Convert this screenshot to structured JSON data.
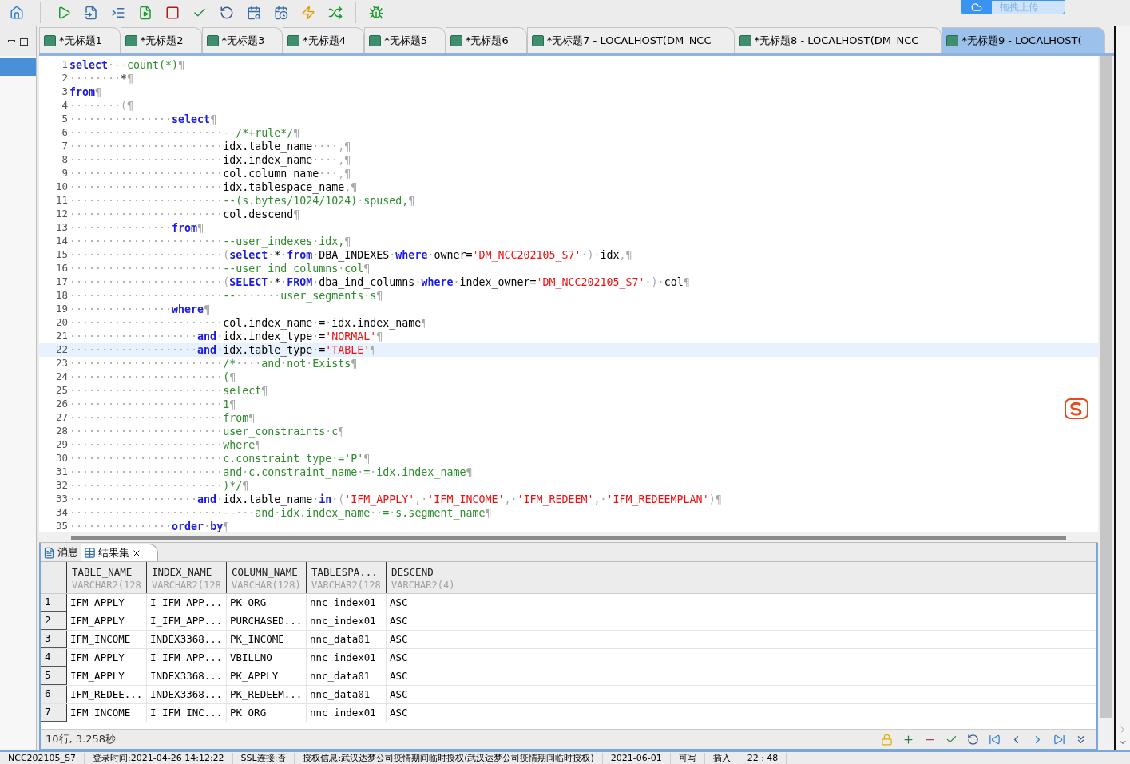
{
  "toolbar": {
    "upload_button": "拖拽上传"
  },
  "tabs": [
    {
      "label": "*无标题1",
      "selected": false
    },
    {
      "label": "*无标题2",
      "selected": false
    },
    {
      "label": "*无标题3",
      "selected": false
    },
    {
      "label": "*无标题4",
      "selected": false
    },
    {
      "label": "*无标题5",
      "selected": false
    },
    {
      "label": "*无标题6",
      "selected": false
    },
    {
      "label": "*无标题7 - LOCALHOST(DM_NCC",
      "selected": false
    },
    {
      "label": "*无标题8 - LOCALHOST(DM_NCC",
      "selected": false
    },
    {
      "label": "*无标题9 - LOCALHOST(",
      "selected": true
    }
  ],
  "editor": {
    "lines": [
      {
        "number": "1",
        "current": false,
        "segments": [
          {
            "kind": "kw",
            "text": "select"
          },
          {
            "kind": "ws",
            "text": "·"
          },
          {
            "kind": "cm",
            "text": "--count(*)"
          },
          {
            "kind": "ws",
            "text": "¶"
          }
        ]
      },
      {
        "number": "2",
        "current": false,
        "segments": [
          {
            "kind": "ws",
            "text": "········"
          },
          {
            "kind": "pl",
            "text": "*"
          },
          {
            "kind": "ws",
            "text": "¶"
          }
        ]
      },
      {
        "number": "3",
        "current": false,
        "segments": [
          {
            "kind": "kw",
            "text": "from"
          },
          {
            "kind": "ws",
            "text": "¶"
          }
        ]
      },
      {
        "number": "4",
        "current": false,
        "segments": [
          {
            "kind": "ws",
            "text": "········(¶"
          }
        ]
      },
      {
        "number": "5",
        "current": false,
        "segments": [
          {
            "kind": "ws",
            "text": "················"
          },
          {
            "kind": "kw",
            "text": "select"
          },
          {
            "kind": "ws",
            "text": "¶"
          }
        ]
      },
      {
        "number": "6",
        "current": false,
        "segments": [
          {
            "kind": "ws",
            "text": "························"
          },
          {
            "kind": "cm",
            "text": "--/*+rule*/"
          },
          {
            "kind": "ws",
            "text": "¶"
          }
        ]
      },
      {
        "number": "7",
        "current": false,
        "segments": [
          {
            "kind": "ws",
            "text": "························"
          },
          {
            "kind": "pl",
            "text": "idx.table_name"
          },
          {
            "kind": "ws",
            "text": "····,¶"
          }
        ]
      },
      {
        "number": "8",
        "current": false,
        "segments": [
          {
            "kind": "ws",
            "text": "························"
          },
          {
            "kind": "pl",
            "text": "idx.index_name"
          },
          {
            "kind": "ws",
            "text": "····,¶"
          }
        ]
      },
      {
        "number": "9",
        "current": false,
        "segments": [
          {
            "kind": "ws",
            "text": "························"
          },
          {
            "kind": "pl",
            "text": "col.column_name"
          },
          {
            "kind": "ws",
            "text": "···,¶"
          }
        ]
      },
      {
        "number": "10",
        "current": false,
        "segments": [
          {
            "kind": "ws",
            "text": "························"
          },
          {
            "kind": "pl",
            "text": "idx.tablespace_name"
          },
          {
            "kind": "ws",
            "text": ",¶"
          }
        ]
      },
      {
        "number": "11",
        "current": false,
        "segments": [
          {
            "kind": "ws",
            "text": "························"
          },
          {
            "kind": "cm",
            "text": "--(s.bytes/1024/1024)"
          },
          {
            "kind": "ws",
            "text": "·"
          },
          {
            "kind": "cm",
            "text": "spused,"
          },
          {
            "kind": "ws",
            "text": "¶"
          }
        ]
      },
      {
        "number": "12",
        "current": false,
        "segments": [
          {
            "kind": "ws",
            "text": "························"
          },
          {
            "kind": "pl",
            "text": "col.descend"
          },
          {
            "kind": "ws",
            "text": "¶"
          }
        ]
      },
      {
        "number": "13",
        "current": false,
        "segments": [
          {
            "kind": "ws",
            "text": "················"
          },
          {
            "kind": "kw",
            "text": "from"
          },
          {
            "kind": "ws",
            "text": "¶"
          }
        ]
      },
      {
        "number": "14",
        "current": false,
        "segments": [
          {
            "kind": "ws",
            "text": "························"
          },
          {
            "kind": "cm",
            "text": "--user_indexes"
          },
          {
            "kind": "ws",
            "text": "·"
          },
          {
            "kind": "cm",
            "text": "idx,"
          },
          {
            "kind": "ws",
            "text": "¶"
          }
        ]
      },
      {
        "number": "15",
        "current": false,
        "segments": [
          {
            "kind": "ws",
            "text": "························("
          },
          {
            "kind": "kw",
            "text": "select"
          },
          {
            "kind": "ws",
            "text": "·"
          },
          {
            "kind": "pl",
            "text": "*"
          },
          {
            "kind": "ws",
            "text": "·"
          },
          {
            "kind": "kw",
            "text": "from"
          },
          {
            "kind": "ws",
            "text": "·"
          },
          {
            "kind": "pl",
            "text": "DBA_INDEXES"
          },
          {
            "kind": "ws",
            "text": "·"
          },
          {
            "kind": "kw",
            "text": "where"
          },
          {
            "kind": "ws",
            "text": "·"
          },
          {
            "kind": "pl",
            "text": "owner="
          },
          {
            "kind": "st",
            "text": "'DM_NCC202105_S7'"
          },
          {
            "kind": "ws",
            "text": "·)·"
          },
          {
            "kind": "pl",
            "text": "idx"
          },
          {
            "kind": "ws",
            "text": ",¶"
          }
        ]
      },
      {
        "number": "16",
        "current": false,
        "segments": [
          {
            "kind": "ws",
            "text": "························"
          },
          {
            "kind": "cm",
            "text": "--user_ind_columns"
          },
          {
            "kind": "ws",
            "text": "·"
          },
          {
            "kind": "cm",
            "text": "col"
          },
          {
            "kind": "ws",
            "text": "¶"
          }
        ]
      },
      {
        "number": "17",
        "current": false,
        "segments": [
          {
            "kind": "ws",
            "text": "························("
          },
          {
            "kind": "kw",
            "text": "SELECT"
          },
          {
            "kind": "ws",
            "text": "·"
          },
          {
            "kind": "pl",
            "text": "*"
          },
          {
            "kind": "ws",
            "text": "·"
          },
          {
            "kind": "kw",
            "text": "FROM"
          },
          {
            "kind": "ws",
            "text": "·"
          },
          {
            "kind": "pl",
            "text": "dba_ind_columns"
          },
          {
            "kind": "ws",
            "text": "·"
          },
          {
            "kind": "kw",
            "text": "where"
          },
          {
            "kind": "ws",
            "text": "·"
          },
          {
            "kind": "pl",
            "text": "index_owner="
          },
          {
            "kind": "st",
            "text": "'DM_NCC202105_S7'"
          },
          {
            "kind": "ws",
            "text": "·)·"
          },
          {
            "kind": "pl",
            "text": "col"
          },
          {
            "kind": "ws",
            "text": "¶"
          }
        ]
      },
      {
        "number": "18",
        "current": false,
        "segments": [
          {
            "kind": "ws",
            "text": "························"
          },
          {
            "kind": "cm",
            "text": "--"
          },
          {
            "kind": "ws",
            "text": "·······"
          },
          {
            "kind": "cm",
            "text": "user_segments"
          },
          {
            "kind": "ws",
            "text": "·"
          },
          {
            "kind": "cm",
            "text": "s"
          },
          {
            "kind": "ws",
            "text": "¶"
          }
        ]
      },
      {
        "number": "19",
        "current": false,
        "segments": [
          {
            "kind": "ws",
            "text": "················"
          },
          {
            "kind": "kw",
            "text": "where"
          },
          {
            "kind": "ws",
            "text": "¶"
          }
        ]
      },
      {
        "number": "20",
        "current": false,
        "segments": [
          {
            "kind": "ws",
            "text": "························"
          },
          {
            "kind": "pl",
            "text": "col.index_name"
          },
          {
            "kind": "ws",
            "text": "·"
          },
          {
            "kind": "pl",
            "text": "="
          },
          {
            "kind": "ws",
            "text": "·"
          },
          {
            "kind": "pl",
            "text": "idx.index_name"
          },
          {
            "kind": "ws",
            "text": "¶"
          }
        ]
      },
      {
        "number": "21",
        "current": false,
        "segments": [
          {
            "kind": "ws",
            "text": "····················"
          },
          {
            "kind": "kw",
            "text": "and"
          },
          {
            "kind": "ws",
            "text": "·"
          },
          {
            "kind": "pl",
            "text": "idx.index_type"
          },
          {
            "kind": "ws",
            "text": "·"
          },
          {
            "kind": "pl",
            "text": "="
          },
          {
            "kind": "st",
            "text": "'NORMAL'"
          },
          {
            "kind": "ws",
            "text": "¶"
          }
        ]
      },
      {
        "number": "22",
        "current": true,
        "segments": [
          {
            "kind": "ws",
            "text": "····················"
          },
          {
            "kind": "kw",
            "text": "and"
          },
          {
            "kind": "ws",
            "text": "·"
          },
          {
            "kind": "pl",
            "text": "idx.table_type"
          },
          {
            "kind": "ws",
            "text": "·"
          },
          {
            "kind": "pl",
            "text": "="
          },
          {
            "kind": "st",
            "text": "'TABLE'"
          },
          {
            "kind": "ws",
            "text": "¶"
          }
        ]
      },
      {
        "number": "23",
        "current": false,
        "segments": [
          {
            "kind": "ws",
            "text": "························"
          },
          {
            "kind": "cm",
            "text": "/*"
          },
          {
            "kind": "ws",
            "text": "····"
          },
          {
            "kind": "cm",
            "text": "and"
          },
          {
            "kind": "ws",
            "text": "·"
          },
          {
            "kind": "cm",
            "text": "not"
          },
          {
            "kind": "ws",
            "text": "·"
          },
          {
            "kind": "cm",
            "text": "Exists"
          },
          {
            "kind": "ws",
            "text": "¶"
          }
        ]
      },
      {
        "number": "24",
        "current": false,
        "segments": [
          {
            "kind": "ws",
            "text": "························"
          },
          {
            "kind": "cm",
            "text": "("
          },
          {
            "kind": "ws",
            "text": "¶"
          }
        ]
      },
      {
        "number": "25",
        "current": false,
        "segments": [
          {
            "kind": "ws",
            "text": "························"
          },
          {
            "kind": "cm",
            "text": "select"
          },
          {
            "kind": "ws",
            "text": "¶"
          }
        ]
      },
      {
        "number": "26",
        "current": false,
        "segments": [
          {
            "kind": "ws",
            "text": "························"
          },
          {
            "kind": "cm",
            "text": "1"
          },
          {
            "kind": "ws",
            "text": "¶"
          }
        ]
      },
      {
        "number": "27",
        "current": false,
        "segments": [
          {
            "kind": "ws",
            "text": "························"
          },
          {
            "kind": "cm",
            "text": "from"
          },
          {
            "kind": "ws",
            "text": "¶"
          }
        ]
      },
      {
        "number": "28",
        "current": false,
        "segments": [
          {
            "kind": "ws",
            "text": "························"
          },
          {
            "kind": "cm",
            "text": "user_constraints"
          },
          {
            "kind": "ws",
            "text": "·"
          },
          {
            "kind": "cm",
            "text": "c"
          },
          {
            "kind": "ws",
            "text": "¶"
          }
        ]
      },
      {
        "number": "29",
        "current": false,
        "segments": [
          {
            "kind": "ws",
            "text": "························"
          },
          {
            "kind": "cm",
            "text": "where"
          },
          {
            "kind": "ws",
            "text": "¶"
          }
        ]
      },
      {
        "number": "30",
        "current": false,
        "segments": [
          {
            "kind": "ws",
            "text": "························"
          },
          {
            "kind": "cm",
            "text": "c.constraint_type"
          },
          {
            "kind": "ws",
            "text": "·"
          },
          {
            "kind": "cm",
            "text": "='P'"
          },
          {
            "kind": "ws",
            "text": "¶"
          }
        ]
      },
      {
        "number": "31",
        "current": false,
        "segments": [
          {
            "kind": "ws",
            "text": "························"
          },
          {
            "kind": "cm",
            "text": "and"
          },
          {
            "kind": "ws",
            "text": "·"
          },
          {
            "kind": "cm",
            "text": "c.constraint_name"
          },
          {
            "kind": "ws",
            "text": "·"
          },
          {
            "kind": "cm",
            "text": "="
          },
          {
            "kind": "ws",
            "text": "·"
          },
          {
            "kind": "cm",
            "text": "idx.index_name"
          },
          {
            "kind": "ws",
            "text": "¶"
          }
        ]
      },
      {
        "number": "32",
        "current": false,
        "segments": [
          {
            "kind": "ws",
            "text": "························"
          },
          {
            "kind": "cm",
            "text": ")*/"
          },
          {
            "kind": "ws",
            "text": "¶"
          }
        ]
      },
      {
        "number": "33",
        "current": false,
        "segments": [
          {
            "kind": "ws",
            "text": "····················"
          },
          {
            "kind": "kw",
            "text": "and"
          },
          {
            "kind": "ws",
            "text": "·"
          },
          {
            "kind": "pl",
            "text": "idx.table_name"
          },
          {
            "kind": "ws",
            "text": "·"
          },
          {
            "kind": "kw",
            "text": "in"
          },
          {
            "kind": "ws",
            "text": "·("
          },
          {
            "kind": "st",
            "text": "'IFM_APPLY'"
          },
          {
            "kind": "ws",
            "text": ",·"
          },
          {
            "kind": "st",
            "text": "'IFM_INCOME'"
          },
          {
            "kind": "ws",
            "text": ",·"
          },
          {
            "kind": "st",
            "text": "'IFM_REDEEM'"
          },
          {
            "kind": "ws",
            "text": ",·"
          },
          {
            "kind": "st",
            "text": "'IFM_REDEEMPLAN'"
          },
          {
            "kind": "ws",
            "text": ")¶"
          }
        ]
      },
      {
        "number": "34",
        "current": false,
        "segments": [
          {
            "kind": "ws",
            "text": "························"
          },
          {
            "kind": "cm",
            "text": "--"
          },
          {
            "kind": "ws",
            "text": "···"
          },
          {
            "kind": "cm",
            "text": "and"
          },
          {
            "kind": "ws",
            "text": "·"
          },
          {
            "kind": "cm",
            "text": "idx.index_name"
          },
          {
            "kind": "ws",
            "text": "··"
          },
          {
            "kind": "cm",
            "text": "="
          },
          {
            "kind": "ws",
            "text": "·"
          },
          {
            "kind": "cm",
            "text": "s.segment_name"
          },
          {
            "kind": "ws",
            "text": "¶"
          }
        ]
      },
      {
        "number": "35",
        "current": false,
        "segments": [
          {
            "kind": "ws",
            "text": "················"
          },
          {
            "kind": "kw",
            "text": "order"
          },
          {
            "kind": "ws",
            "text": "·"
          },
          {
            "kind": "kw",
            "text": "by"
          },
          {
            "kind": "ws",
            "text": "¶"
          }
        ]
      }
    ]
  },
  "results": {
    "tabs": [
      {
        "label": "消息",
        "selected": false
      },
      {
        "label": "结果集",
        "selected": true
      }
    ],
    "columns": [
      {
        "name": "TABLE_NAME",
        "type": "VARCHAR2(128"
      },
      {
        "name": "INDEX_NAME",
        "type": "VARCHAR2(128"
      },
      {
        "name": "COLUMN_NAME",
        "type": "VARCHAR(128)"
      },
      {
        "name": "TABLESPA...",
        "type": "VARCHAR2(128"
      },
      {
        "name": "DESCEND",
        "type": "VARCHAR2(4)"
      }
    ],
    "rows": [
      {
        "number": "1",
        "cells": [
          "IFM_APPLY",
          "I_IFM_APP...",
          "PK_ORG",
          "nnc_index01",
          "ASC"
        ]
      },
      {
        "number": "2",
        "cells": [
          "IFM_APPLY",
          "I_IFM_APP...",
          "PURCHASED...",
          "nnc_index01",
          "ASC"
        ]
      },
      {
        "number": "3",
        "cells": [
          "IFM_INCOME",
          "INDEX3368...",
          "PK_INCOME",
          "nnc_data01",
          "ASC"
        ]
      },
      {
        "number": "4",
        "cells": [
          "IFM_APPLY",
          "I_IFM_APP...",
          "VBILLNO",
          "nnc_index01",
          "ASC"
        ]
      },
      {
        "number": "5",
        "cells": [
          "IFM_APPLY",
          "INDEX3368...",
          "PK_APPLY",
          "nnc_data01",
          "ASC"
        ]
      },
      {
        "number": "6",
        "cells": [
          "IFM_REDEE...",
          "INDEX3368...",
          "PK_REDEEM...",
          "nnc_data01",
          "ASC"
        ]
      },
      {
        "number": "7",
        "cells": [
          "IFM_INCOME",
          "I_IFM_INC...",
          "PK_ORG",
          "nnc_index01",
          "ASC"
        ]
      }
    ],
    "summary": "10行, 3.258秒"
  },
  "status_bar": [
    "NCC202105_S7",
    "登录时间:2021-04-26 14:12:22",
    "SSL连接:否",
    "授权信息:武汉达梦公司疫情期间临时授权(武汉达梦公司疫情期间临时授权)",
    "2021-06-01",
    "可写",
    "插入",
    "22 : 48"
  ]
}
